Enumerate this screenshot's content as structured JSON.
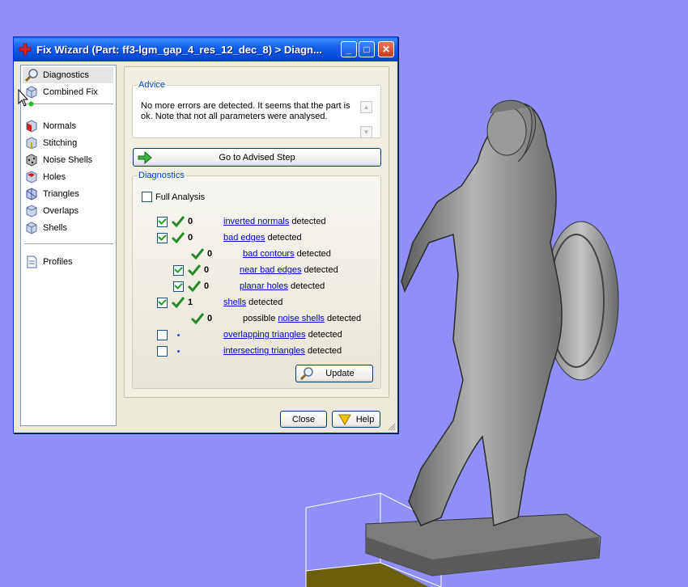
{
  "window": {
    "title": "Fix Wizard (Part: ff3-lgm_gap_4_res_12_dec_8) > Diagn...",
    "min_glyph": "_",
    "max_glyph": "□",
    "close_glyph": "✕"
  },
  "nav": {
    "items": [
      {
        "label": "Diagnostics",
        "icon": "magnifier-icon"
      },
      {
        "label": "Combined Fix",
        "icon": "cube-icon"
      },
      {
        "label": "Normals",
        "icon": "normals-cube-icon"
      },
      {
        "label": "Stitching",
        "icon": "stitching-cube-icon"
      },
      {
        "label": "Noise Shells",
        "icon": "noise-cube-icon"
      },
      {
        "label": "Holes",
        "icon": "holes-cube-icon"
      },
      {
        "label": "Triangles",
        "icon": "triangles-cube-icon"
      },
      {
        "label": "Overlaps",
        "icon": "overlaps-cube-icon"
      },
      {
        "label": "Shells",
        "icon": "shells-cube-icon"
      },
      {
        "label": "Profiles",
        "icon": "document-icon"
      }
    ]
  },
  "advice": {
    "legend": "Advice",
    "text": "No more errors are detected. It seems that the part is ok. Note that not all parameters were analysed."
  },
  "advised_button": "Go to Advised Step",
  "diagnostics": {
    "legend": "Diagnostics",
    "full_analysis": "Full Analysis",
    "rows": [
      {
        "count": "0",
        "prefix": "",
        "link": "inverted normals",
        "suffix": " detected"
      },
      {
        "count": "0",
        "prefix": "",
        "link": "bad edges",
        "suffix": " detected"
      },
      {
        "count": "0",
        "prefix": "",
        "link": "bad contours",
        "suffix": " detected"
      },
      {
        "count": "0",
        "prefix": "",
        "link": "near bad edges",
        "suffix": " detected"
      },
      {
        "count": "0",
        "prefix": "",
        "link": "planar holes",
        "suffix": " detected"
      },
      {
        "count": "1",
        "prefix": "",
        "link": "shells",
        "suffix": " detected"
      },
      {
        "count": "0",
        "prefix": "possible ",
        "link": "noise shells",
        "suffix": " detected"
      },
      {
        "count": "",
        "prefix": "",
        "link": "overlapping triangles",
        "suffix": " detected"
      },
      {
        "count": "",
        "prefix": "",
        "link": "intersecting triangles",
        "suffix": " detected"
      }
    ],
    "update_button": "Update"
  },
  "footer": {
    "close_button": "Close",
    "help_button": "Help"
  },
  "colors": {
    "viewport_bg": "#8f8ff7",
    "title_blue": "#0a5ff0",
    "link_blue": "#0000cc",
    "check_green": "#2a8a2a"
  }
}
